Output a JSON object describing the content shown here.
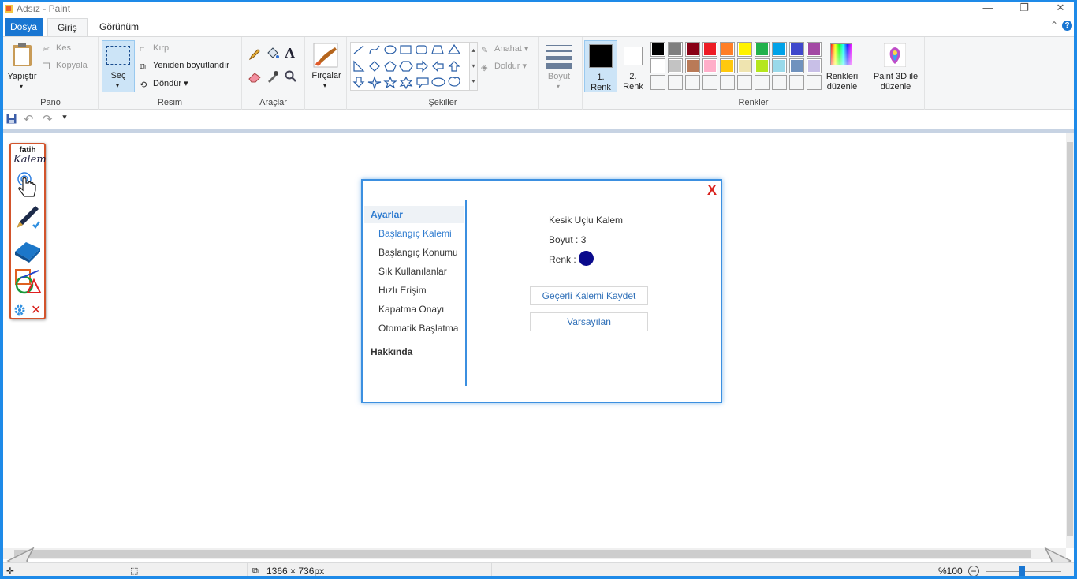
{
  "window": {
    "title": "Adsız - Paint",
    "controls": {
      "minimize": "—",
      "maximize": "❐",
      "close": "✕"
    }
  },
  "tabs": {
    "file": "Dosya",
    "items": [
      {
        "label": "Giriş",
        "active": true
      },
      {
        "label": "Görünüm",
        "active": false
      }
    ],
    "collapse": "⌃",
    "help": "?"
  },
  "ribbon": {
    "clipboard": {
      "label": "Pano",
      "paste": "Yapıştır",
      "cut": "Kes",
      "copy": "Kopyala"
    },
    "image": {
      "label": "Resim",
      "select": "Seç",
      "crop": "Kırp",
      "resize": "Yeniden boyutlandır",
      "rotate": "Döndür"
    },
    "tools": {
      "label": "Araçlar"
    },
    "brushes": {
      "label": "Fırçalar"
    },
    "shapes": {
      "label": "Şekiller",
      "outline": "Anahat",
      "fill": "Doldur"
    },
    "size": {
      "label": "Boyut"
    },
    "colors": {
      "label": "Renkler",
      "color1": "1. Renk",
      "color1_line1": "1.",
      "color1_line2": "Renk",
      "color2_line1": "2.",
      "color2_line2": "Renk",
      "edit_line1": "Renkleri",
      "edit_line2": "düzenle",
      "palette_row1": [
        "#000000",
        "#7f7f7f",
        "#880015",
        "#ed1c24",
        "#ff7f27",
        "#fff200",
        "#22b14c",
        "#00a2e8",
        "#3f48cc",
        "#a349a4"
      ],
      "palette_row2": [
        "#ffffff",
        "#c3c3c3",
        "#b97a57",
        "#ffaec9",
        "#ffc90e",
        "#efe4b0",
        "#b5e61d",
        "#99d9ea",
        "#7092be",
        "#c8bfe7"
      ]
    },
    "paint3d": {
      "line1": "Paint 3D ile",
      "line2": "düzenle"
    }
  },
  "status": {
    "dimensions": "1366 × 736px",
    "zoom": "%100"
  },
  "dialog": {
    "close": "X",
    "nav": {
      "settings_head": "Ayarlar",
      "items": [
        "Başlangıç Kalemi",
        "Başlangıç Konumu",
        "Sık Kullanılanlar",
        "Hızlı Erişim",
        "Kapatma Onayı",
        "Otomatik Başlatma"
      ],
      "about_head": "Hakkında"
    },
    "pen_type": "Kesik Uçlu Kalem",
    "size_text": "Boyut : 3",
    "color_label": "Renk :",
    "pen_color": "#0a0a8c",
    "save_button": "Geçerli Kalemi Kaydet",
    "default_button": "Varsayılan"
  },
  "fatih": {
    "logo_top": "fatih",
    "logo_bottom": "Kalem",
    "close": "✕"
  }
}
